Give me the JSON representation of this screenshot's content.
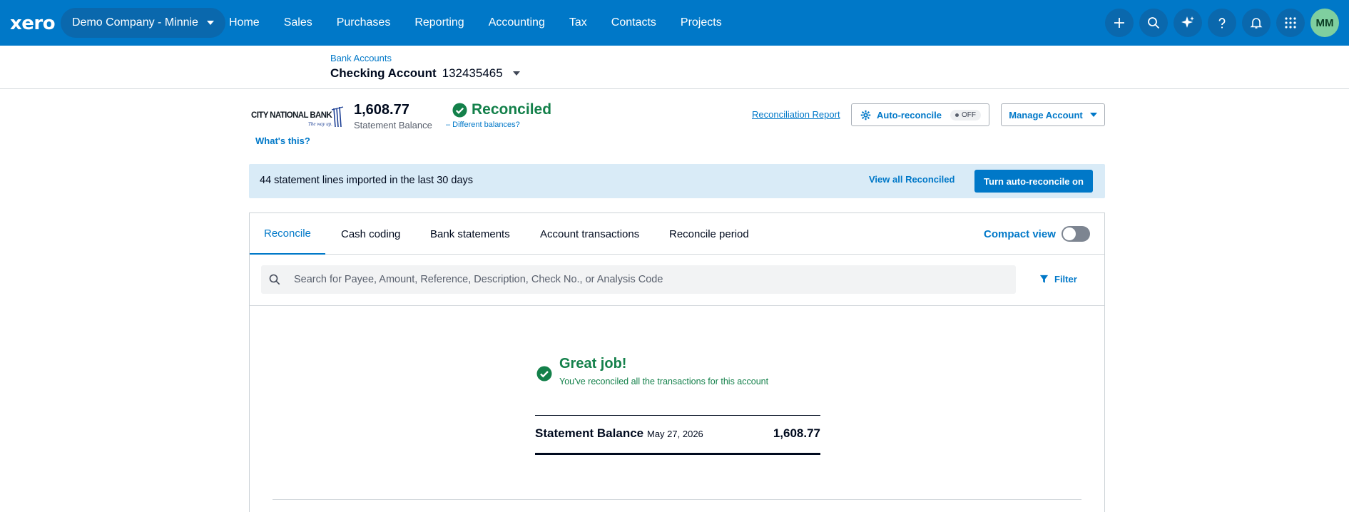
{
  "nav": {
    "logo": "xero",
    "org": "Demo Company - Minnie",
    "items": [
      "Home",
      "Sales",
      "Purchases",
      "Reporting",
      "Accounting",
      "Tax",
      "Contacts",
      "Projects"
    ],
    "avatar_initials": "MM",
    "icons": [
      "plus-icon",
      "search-icon",
      "sparkle-icon",
      "help-icon",
      "bell-icon",
      "apps-grid-icon"
    ]
  },
  "header": {
    "breadcrumb": "Bank Accounts",
    "account_name": "Checking Account",
    "account_number": "132435465"
  },
  "summary": {
    "bank_logo_text": "CITY NATIONAL BANK",
    "bank_tagline": "The way up.",
    "whats_this": "What's this?",
    "statement_balance": "1,608.77",
    "statement_balance_label": "Statement Balance",
    "status": "Reconciled",
    "different_balances": "– Different balances?",
    "reconciliation_report": "Reconciliation Report",
    "auto_reconcile_label": "Auto-reconcile",
    "auto_reconcile_state": "OFF",
    "manage_account": "Manage Account"
  },
  "info_bar": {
    "text": "44 statement lines imported in the last 30 days",
    "view_all": "View all Reconciled",
    "turn_on": "Turn auto-reconcile on"
  },
  "tabs": {
    "items": [
      "Reconcile",
      "Cash coding",
      "Bank statements",
      "Account transactions",
      "Reconcile period"
    ],
    "active": "Reconcile",
    "compact_view": "Compact view"
  },
  "search": {
    "placeholder": "Search for Payee, Amount, Reference, Description, Check No., or Analysis Code",
    "filter": "Filter"
  },
  "result": {
    "title": "Great job!",
    "subtitle": "You've reconciled all the transactions for this account",
    "statement_label": "Statement Balance",
    "statement_date": "May 27, 2026",
    "statement_amount": "1,608.77"
  },
  "colors": {
    "brand": "#0078c8",
    "success": "#13804a",
    "info_bg": "#d9ebf7"
  }
}
